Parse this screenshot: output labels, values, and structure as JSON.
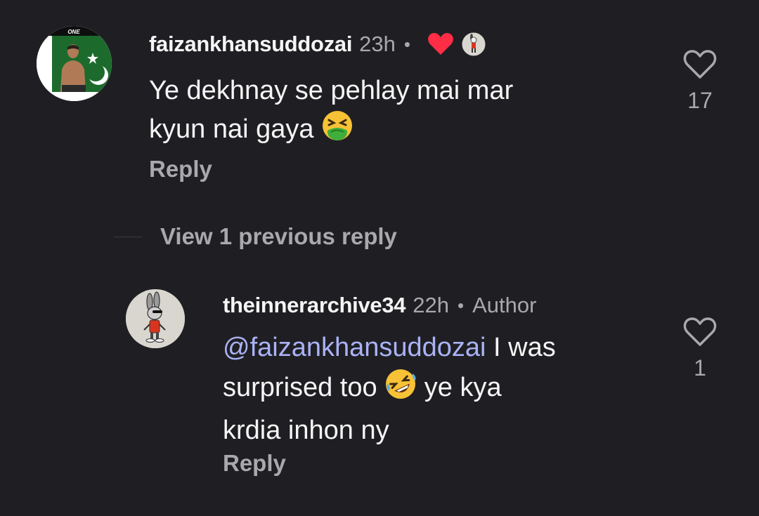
{
  "comment": {
    "username": "faizankhansuddozai",
    "time": "23h",
    "separator": "•",
    "avatar_badge": "ONE",
    "text_line1": "Ye dekhnay se pehlay mai mar",
    "text_line2": "kyun nai gaya",
    "reply_label": "Reply",
    "like_count": "17",
    "liked_by_author_icon": "heart-icon",
    "emoji": "nauseated-face"
  },
  "view_replies": {
    "label": "View 1 previous reply"
  },
  "reply": {
    "username": "theinnerarchive34",
    "time": "22h",
    "separator": "•",
    "role_badge": "Author",
    "mention": "@faizankhansuddozai",
    "text_line1_rest": " I was",
    "text_line2_start": "surprised too ",
    "text_line2_end": " ye kya",
    "text_line3": "krdia inhon ny",
    "reply_label": "Reply",
    "like_count": "1",
    "emoji": "rolling-on-the-floor-laughing"
  },
  "colors": {
    "background": "#1f1f23",
    "text": "#f5f5f5",
    "secondary": "#a8a8ad",
    "mention": "#aab2f5",
    "heart": "#ff2d45"
  }
}
